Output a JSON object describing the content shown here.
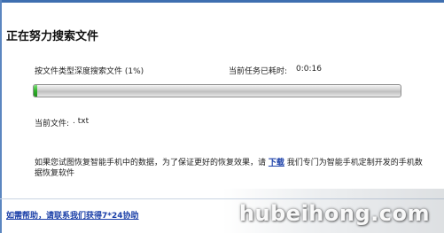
{
  "dialog": {
    "heading": "正在努力搜索文件",
    "status_label": "按文件类型深度搜索文件 (1%)",
    "elapsed_label": "当前任务已耗时:",
    "elapsed_value": "0:0:16",
    "progress_percent": 1,
    "current_file_label": "当前文件:",
    "current_file_value": ". txt",
    "notice_before_link": "如果您试图恢复智能手机中的数据，为了保证更好的恢复效果，请 ",
    "notice_link": "下载",
    "notice_after_link": " 我们专门为智能手机定制开发的手机数据恢复软件",
    "help_link": "如需帮助，请联系我们获得7*24协助"
  },
  "watermark": {
    "text": "hubeihong.com"
  },
  "colors": {
    "accent": "#3e6fb0",
    "progress_fill": "#2fb12a",
    "link": "#1a3fa8"
  }
}
